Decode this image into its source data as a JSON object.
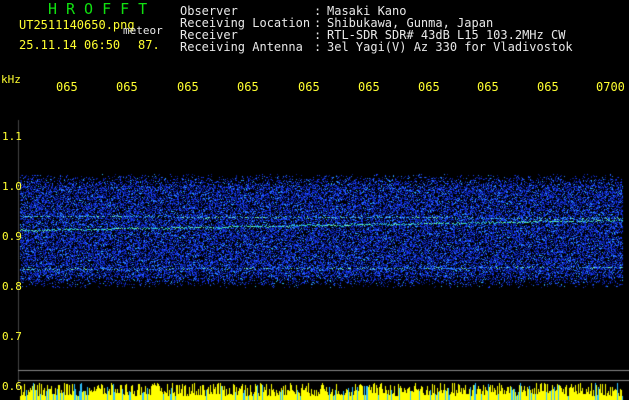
{
  "header": {
    "logo": "HROFFT",
    "filename": "UT2511140650.png",
    "mode": "meteor",
    "datetime": "25.11.14 06:50",
    "count": "87."
  },
  "info": [
    {
      "label": "Observer",
      "value": "Masaki Kano"
    },
    {
      "label": "Receiving Location",
      "value": "Shibukawa, Gunma, Japan"
    },
    {
      "label": "Receiver",
      "value": "RTL-SDR SDR# 43dB L15 103.2MHz CW"
    },
    {
      "label": "Receiving Antenna",
      "value": "3el Yagi(V) Az 330 for Vladivostok"
    }
  ],
  "colon": ":",
  "axis": {
    "unit": "kHz",
    "y_ticks": [
      "1.1",
      "1.0",
      "0.9",
      "0.8",
      "0.7",
      "0.6"
    ],
    "x_ticks": [
      "065",
      "065",
      "065",
      "065",
      "065",
      "065",
      "065",
      "065",
      "065",
      "0700"
    ]
  },
  "colors": {
    "background": "#000000",
    "text_yellow": "#ffff30",
    "text_white": "#e8e8e8",
    "logo_green": "#10e010",
    "noise_blue": "#1a3cff",
    "signal_green": "#40ff80",
    "baseline_yellow": "#ffff00"
  }
}
